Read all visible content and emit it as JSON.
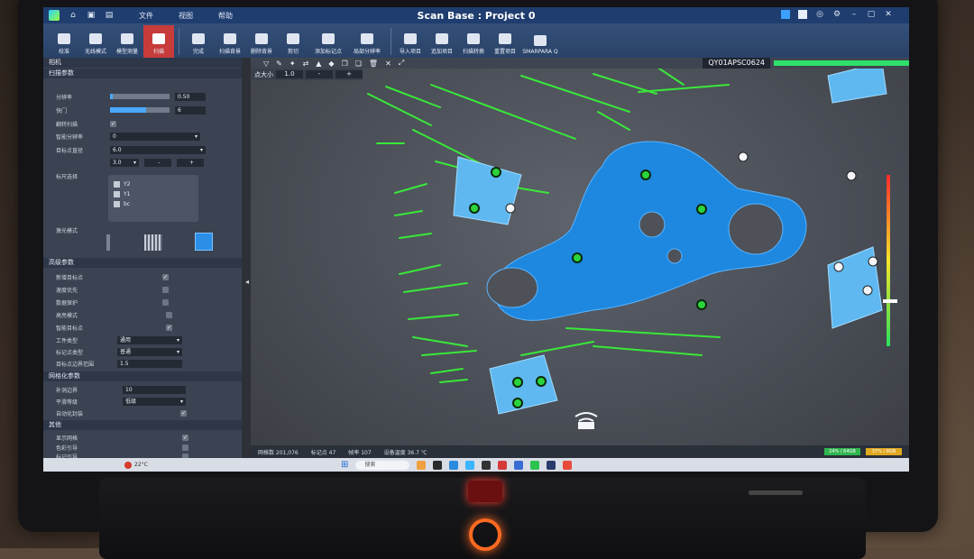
{
  "window": {
    "title": "Scan Base : Project 0",
    "menu": [
      "文件",
      "视图",
      "帮助"
    ]
  },
  "ribbon": {
    "buttons": [
      {
        "label": "校准",
        "icon": "calibrate-icon"
      },
      {
        "label": "无线模式",
        "icon": "wireless-icon"
      },
      {
        "label": "模型测量",
        "icon": "measure-icon"
      },
      {
        "label": "扫描",
        "icon": "scan-icon",
        "active": true
      },
      {
        "label": "完成",
        "icon": "finish-icon"
      },
      {
        "label": "扫描背景",
        "icon": "scan-background-icon"
      },
      {
        "label": "删除背景",
        "icon": "delete-background-icon"
      },
      {
        "label": "剪切",
        "icon": "cut-icon"
      },
      {
        "label": "添加标记点",
        "icon": "add-marker-icon"
      },
      {
        "label": "局部分辨率",
        "icon": "local-resolution-icon"
      },
      {
        "label": "导入项目",
        "icon": "import-project-icon"
      },
      {
        "label": "追加项目",
        "icon": "append-project-icon"
      },
      {
        "label": "扫描转换",
        "icon": "scan-convert-icon"
      },
      {
        "label": "重置项目",
        "icon": "reset-project-icon"
      },
      {
        "label": "SMARPARA Q",
        "icon": "smarpara-icon"
      }
    ]
  },
  "left_panel": {
    "top_section": "相机",
    "scan_params": {
      "header": "扫描参数",
      "resolution_label": "分辨率",
      "resolution_value": "0.50",
      "resolution_fill": 0.02,
      "shutter_label": "快门",
      "shutter_value": "6",
      "shutter_fill": 0.6,
      "flip_scan_label": "翻转扫描",
      "smart_res_label": "智能分辨率",
      "smart_res_value": "0",
      "marker_diameter_label": "目标点直径",
      "marker_diameter_value": "6.0",
      "spin_value": "3.0",
      "spin_minus": "-",
      "spin_plus": "+",
      "ruler_label": "标尺选择",
      "ruler_items": [
        "Y2",
        "Y1",
        "bc"
      ],
      "light_mode_label": "激光模式"
    },
    "advanced": {
      "header": "高级参数",
      "items": [
        {
          "label": "新增目标点",
          "checked": true
        },
        {
          "label": "速度优先",
          "checked": false
        },
        {
          "label": "数据保护",
          "checked": false
        },
        {
          "label": "高亮模式",
          "checked": false
        },
        {
          "label": "智能目标点",
          "checked": true
        }
      ],
      "work_mode_label": "工件类型",
      "work_mode_value": "通用",
      "marker_type_label": "标记点类型",
      "marker_type_value": "普通",
      "marker_dist_label": "目标点边界范围",
      "marker_dist_value": "1.5"
    },
    "mesh": {
      "header": "网格化参数",
      "fill_label": "补洞边界",
      "fill_value": "10",
      "smooth_label": "平滑等级",
      "smooth_value": "低级",
      "auto_label": "自动化封装",
      "auto_checked": true
    },
    "other": {
      "header": "其他",
      "items": [
        {
          "label": "显示网格",
          "checked": true
        },
        {
          "label": "色彩引导",
          "checked": false
        },
        {
          "label": "标记引导",
          "checked": false
        }
      ]
    }
  },
  "viewport": {
    "point_size_label": "点大小",
    "point_size_value": "1.0",
    "point_size_minus": "-",
    "point_size_plus": "+",
    "device_name": "QY01APSC0624"
  },
  "statusbar": {
    "items": [
      "网格数  201,076",
      "标记点  47",
      "帧率  107",
      "设备温度  36.7 ℃"
    ],
    "mem1": "24% / 64GB",
    "mem2": "37% / 8GB"
  },
  "taskbar": {
    "weather": "22°C",
    "search": "搜索"
  },
  "colors": {
    "accent": "#1f3d6e",
    "active_tool": "#c83b3b",
    "scan_mesh": "#1e88e0",
    "laser_lines": "#39e83a",
    "marker_green": "#2bd43b"
  }
}
